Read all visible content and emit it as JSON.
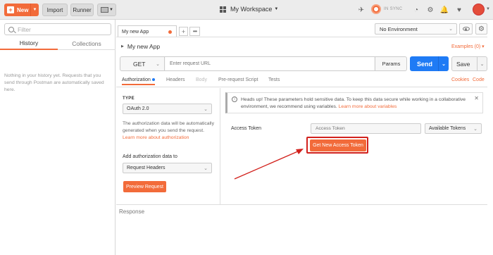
{
  "topbar": {
    "new_label": "New",
    "import_label": "Import",
    "runner_label": "Runner",
    "workspace_label": "My Workspace",
    "sync_label": "IN SYNC"
  },
  "sidebar": {
    "filter_placeholder": "Filter",
    "tabs": [
      {
        "label": "History"
      },
      {
        "label": "Collections"
      }
    ],
    "empty_message": "Nothing in your history yet. Requests that you send through Postman are automatically saved here."
  },
  "request_tabs": [
    {
      "label": "My new App",
      "unsaved": true
    }
  ],
  "environment": {
    "selected": "No Environment"
  },
  "request": {
    "name": "My new App",
    "examples_label": "Examples (0)",
    "method": "GET",
    "url_placeholder": "Enter request URL",
    "params_label": "Params",
    "send_label": "Send",
    "save_label": "Save"
  },
  "subtabs": [
    {
      "label": "Authorization",
      "active": true
    },
    {
      "label": "Headers"
    },
    {
      "label": "Body",
      "disabled": true
    },
    {
      "label": "Pre-request Script"
    },
    {
      "label": "Tests"
    }
  ],
  "subtab_links": {
    "cookies": "Cookies",
    "code": "Code"
  },
  "auth": {
    "type_label": "TYPE",
    "type_value": "OAuth 2.0",
    "description": "The authorization data will be automatically generated when you send the request.",
    "learn_more": "Learn more about authorization",
    "add_to_label": "Add authorization data to",
    "add_to_value": "Request Headers",
    "preview_label": "Preview Request",
    "notice_text": "Heads up! These parameters hold sensitive data. To keep this data secure while working in a collaborative environment, we recommend using variables.",
    "notice_link": "Learn more about variables",
    "access_token_label": "Access Token",
    "access_token_placeholder": "Access Token",
    "available_tokens": "Available Tokens",
    "get_new_token_label": "Get New Access Token"
  },
  "response": {
    "label": "Response"
  },
  "colors": {
    "accent": "#f26b3a",
    "send": "#1f7bf5",
    "highlight": "#d2211c"
  }
}
